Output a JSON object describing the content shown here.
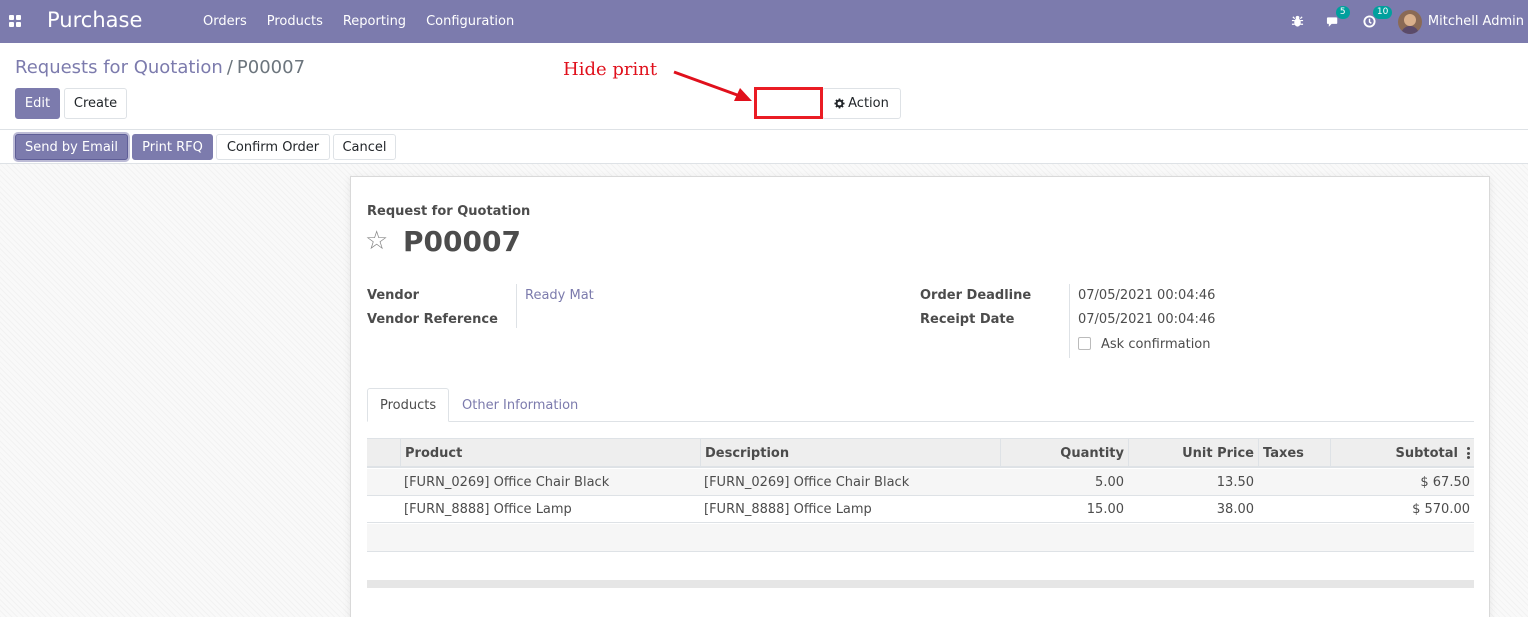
{
  "navbar": {
    "app_name": "Purchase",
    "menu": [
      "Orders",
      "Products",
      "Reporting",
      "Configuration"
    ],
    "messages_badge": "5",
    "activities_badge": "10",
    "user_name": "Mitchell Admin"
  },
  "breadcrumb": {
    "parent": "Requests for Quotation",
    "separator": "/",
    "current": "P00007"
  },
  "control": {
    "edit_label": "Edit",
    "create_label": "Create",
    "action_label": "Action"
  },
  "annotation": {
    "text": "Hide print"
  },
  "statusbar": {
    "buttons": [
      "Send by Email",
      "Print RFQ",
      "Confirm Order",
      "Cancel"
    ]
  },
  "form": {
    "title_label": "Request for Quotation",
    "name": "P00007",
    "vendor_label": "Vendor",
    "vendor_value": "Ready Mat",
    "vendor_ref_label": "Vendor Reference",
    "deadline_label": "Order Deadline",
    "deadline_value": "07/05/2021 00:04:46",
    "receipt_label": "Receipt Date",
    "receipt_value": "07/05/2021 00:04:46",
    "ask_confirmation_label": "Ask confirmation",
    "ask_confirmation_checked": false
  },
  "tabs": [
    "Products",
    "Other Information"
  ],
  "table": {
    "headers": [
      "Product",
      "Description",
      "Quantity",
      "Unit Price",
      "Taxes",
      "Subtotal"
    ],
    "rows": [
      [
        "[FURN_0269] Office Chair Black",
        "[FURN_0269] Office Chair Black",
        "5.00",
        "13.50",
        "",
        "$ 67.50"
      ],
      [
        "[FURN_8888] Office Lamp",
        "[FURN_8888] Office Lamp",
        "15.00",
        "38.00",
        "",
        "$ 570.00"
      ]
    ]
  },
  "colors": {
    "brand": "#7c7bad",
    "annotation": "#e0101c"
  }
}
